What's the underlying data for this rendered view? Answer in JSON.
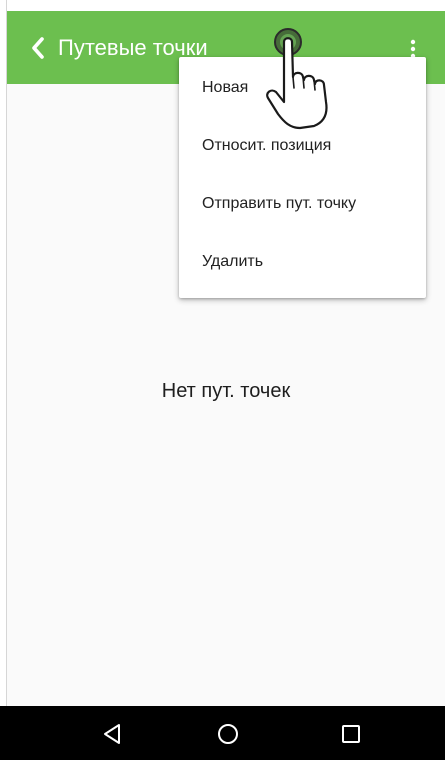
{
  "app_bar": {
    "title": "Путевые точки",
    "color": "#6cbf4f",
    "back_icon": "chevron-left-icon",
    "overflow_icon": "more-vert-icon"
  },
  "menu": {
    "items": [
      {
        "label": "Новая"
      },
      {
        "label": "Относит. позиция"
      },
      {
        "label": "Отправить пут. точку"
      },
      {
        "label": "Удалить"
      }
    ]
  },
  "empty_state": {
    "text": "Нет пут. точек"
  },
  "nav_bar": {
    "back_icon": "triangle-back-icon",
    "home_icon": "circle-home-icon",
    "recents_icon": "square-recents-icon"
  },
  "overlay": {
    "icon": "tap-hand-icon"
  }
}
